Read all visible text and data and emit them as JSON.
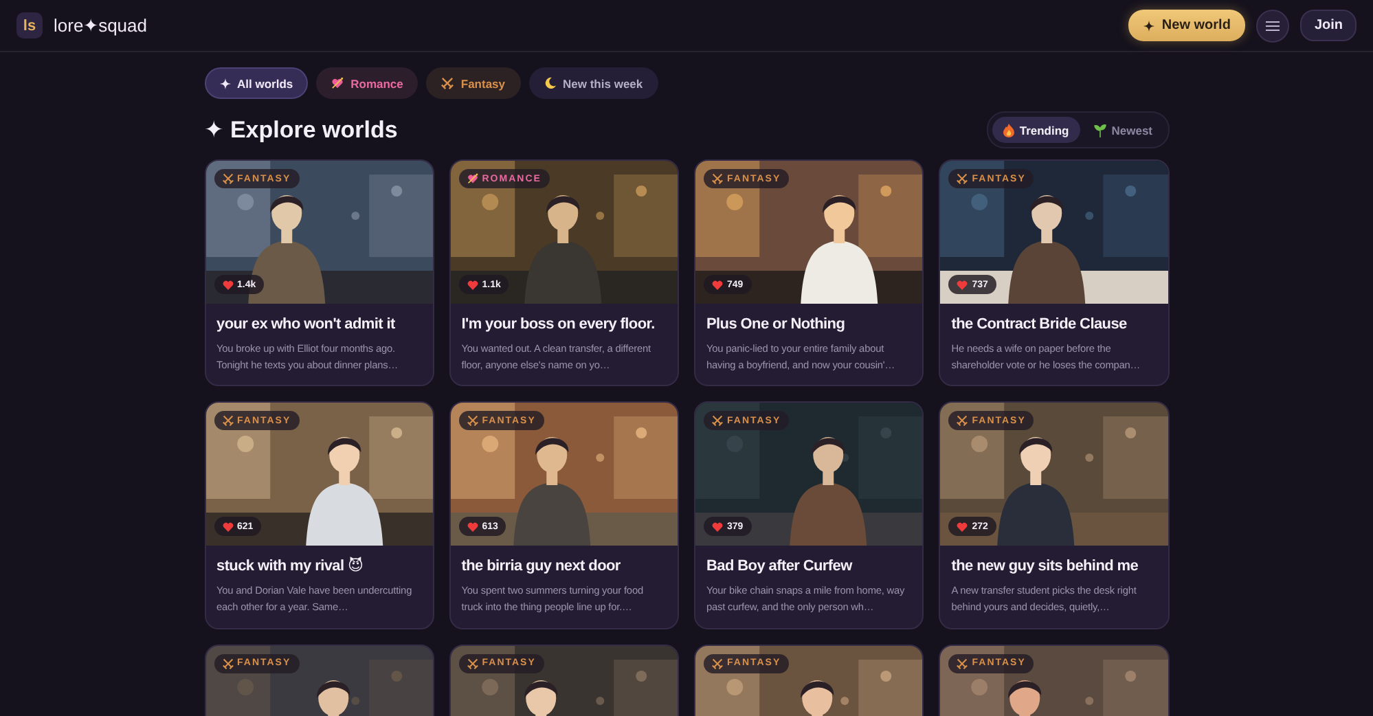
{
  "brand": {
    "logo": "ls",
    "name": "lore✦squad"
  },
  "header_actions": {
    "new_world": "New world",
    "join": "Join"
  },
  "filters": [
    {
      "kind": "all",
      "label": "All worlds",
      "selected": true
    },
    {
      "kind": "romance",
      "label": "Romance",
      "selected": false
    },
    {
      "kind": "fantasy",
      "label": "Fantasy",
      "selected": false
    },
    {
      "kind": "new",
      "label": "New this week",
      "selected": false
    }
  ],
  "section_title": "✦ Explore worlds",
  "sort": [
    {
      "kind": "trending",
      "label": "Trending",
      "selected": true
    },
    {
      "kind": "newest",
      "label": "Newest",
      "selected": false
    }
  ],
  "worlds": [
    {
      "kind": "fantasy",
      "tag": "FANTASY",
      "likes": "1.4k",
      "title": "your ex who won't admit it",
      "description": "You broke up with Elliot four months ago. Tonight he texts you about dinner plans…"
    },
    {
      "kind": "romance",
      "tag": "ROMANCE",
      "likes": "1.1k",
      "title": "I'm your boss on every floor.",
      "description": "You wanted out. A clean transfer, a different floor, anyone else's name on yo…"
    },
    {
      "kind": "fantasy",
      "tag": "FANTASY",
      "likes": "749",
      "title": "Plus One or Nothing",
      "description": "You panic-lied to your entire family about having a boyfriend, and now your cousin'…"
    },
    {
      "kind": "fantasy",
      "tag": "FANTASY",
      "likes": "737",
      "title": "the Contract Bride Clause",
      "description": "He needs a wife on paper before the shareholder vote or he loses the compan…"
    },
    {
      "kind": "fantasy",
      "tag": "FANTASY",
      "likes": "621",
      "title": "stuck with my rival 😈",
      "description": "You and Dorian Vale have been undercutting each other for a year. Same…"
    },
    {
      "kind": "fantasy",
      "tag": "FANTASY",
      "likes": "613",
      "title": "the birria guy next door",
      "description": "You spent two summers turning your food truck into the thing people line up for.…"
    },
    {
      "kind": "fantasy",
      "tag": "FANTASY",
      "likes": "379",
      "title": "Bad Boy after Curfew",
      "description": "Your bike chain snaps a mile from home, way past curfew, and the only person wh…"
    },
    {
      "kind": "fantasy",
      "tag": "FANTASY",
      "likes": "272",
      "title": "the new guy sits behind me",
      "description": "A new transfer student picks the desk right behind yours and decides, quietly,…"
    },
    {
      "kind": "fantasy",
      "tag": "FANTASY"
    },
    {
      "kind": "fantasy",
      "tag": "FANTASY"
    },
    {
      "kind": "fantasy",
      "tag": "FANTASY"
    },
    {
      "kind": "fantasy",
      "tag": "FANTASY"
    }
  ]
}
